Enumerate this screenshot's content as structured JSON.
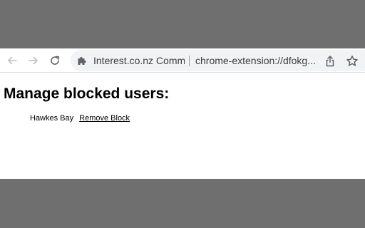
{
  "colors": {
    "backdrop": "#6f6f6f",
    "toolbar_bg": "#ffffff",
    "omnibox_bg": "#f1f3f4",
    "icon": "#5f6368",
    "icon_disabled": "#bdc1c6",
    "text": "#3c4043"
  },
  "browser": {
    "extension_name": "Interest.co.nz Comm",
    "url": "chrome-extension://dfokg...",
    "icons": {
      "back": "arrow-left-icon",
      "forward": "arrow-right-icon",
      "reload": "reload-icon",
      "extension": "puzzle-piece-icon",
      "share": "share-icon",
      "bookmark": "star-icon"
    }
  },
  "page": {
    "title": "Manage blocked users:",
    "blocked_users": [
      {
        "name": "Hawkes Bay",
        "action_label": "Remove Block"
      }
    ]
  }
}
